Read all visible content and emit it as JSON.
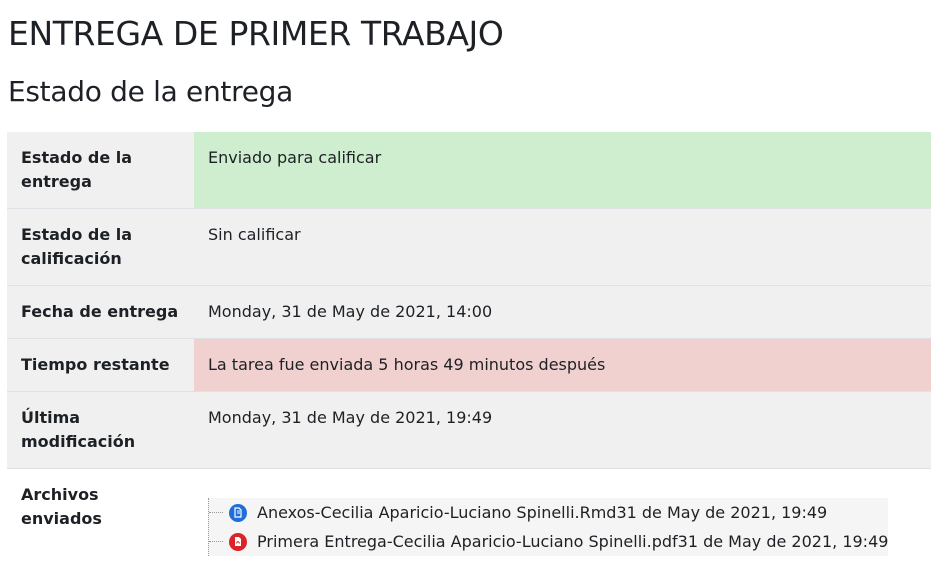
{
  "page": {
    "title": "ENTREGA DE PRIMER TRABAJO",
    "section_title": "Estado de la entrega"
  },
  "status_table": {
    "rows": [
      {
        "label": "Estado de la entrega",
        "value": "Enviado para calificar"
      },
      {
        "label": "Estado de la calificación",
        "value": "Sin calificar"
      },
      {
        "label": "Fecha de entrega",
        "value": "Monday, 31 de May de 2021, 14:00"
      },
      {
        "label": "Tiempo restante",
        "value": "La tarea fue enviada 5 horas 49 minutos después"
      },
      {
        "label": "Última modificación",
        "value": "Monday, 31 de May de 2021, 19:49"
      },
      {
        "label": "Archivos enviados",
        "value": ""
      }
    ]
  },
  "files": [
    {
      "name": "Anexos-Cecilia Aparicio-Luciano Spinelli.Rmd",
      "date": "31 de May de 2021, 19:49",
      "icon": "document-icon",
      "icon_color": "#1f6fd6"
    },
    {
      "name": "Primera Entrega-Cecilia Aparicio-Luciano Spinelli.pdf",
      "date": "31 de May de 2021, 19:49",
      "icon": "pdf-icon",
      "icon_color": "#d9252a"
    }
  ],
  "colors": {
    "submitted_bg": "#cfeed0",
    "late_bg": "#f1d0d0",
    "row_grey": "#f0f0f0"
  }
}
